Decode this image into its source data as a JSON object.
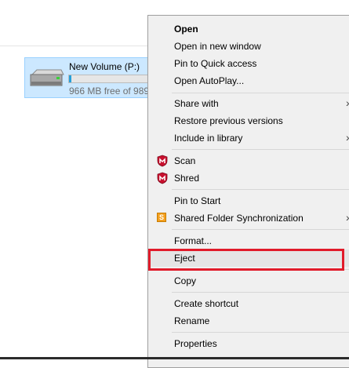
{
  "drive": {
    "name": "New Volume (P:)",
    "free_text": "966 MB free of 989",
    "used_fraction": 0.03
  },
  "menu": {
    "items": {
      "open": "Open",
      "open_new_window": "Open in new window",
      "pin_quick_access": "Pin to Quick access",
      "open_autoplay": "Open AutoPlay...",
      "share_with": "Share with",
      "restore_previous": "Restore previous versions",
      "include_library": "Include in library",
      "scan": "Scan",
      "shred": "Shred",
      "pin_start": "Pin to Start",
      "shared_folder_sync": "Shared Folder Synchronization",
      "format": "Format...",
      "eject": "Eject",
      "copy": "Copy",
      "create_shortcut": "Create shortcut",
      "rename": "Rename",
      "properties": "Properties"
    },
    "submenu_arrow": "›",
    "sync_icon_glyph": "S"
  },
  "colors": {
    "highlight_box": "#e11b2a",
    "selection_bg": "#cce8ff",
    "mcafee_red": "#c8102e"
  },
  "icons": {
    "drive": "hard-drive-icon",
    "scan": "mcafee-shield-icon",
    "shred": "mcafee-shield-icon",
    "sync": "shared-folder-sync-icon"
  }
}
